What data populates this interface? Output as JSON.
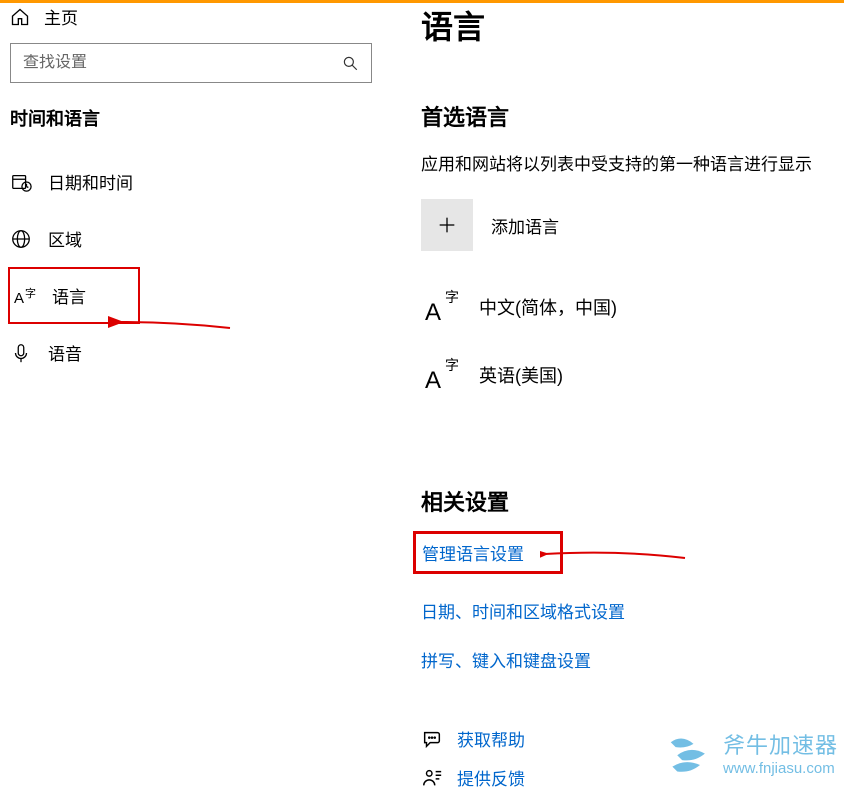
{
  "sidebar": {
    "home_label": "主页",
    "search_placeholder": "查找设置",
    "section_title": "时间和语言",
    "items": [
      {
        "label": "日期和时间"
      },
      {
        "label": "区域"
      },
      {
        "label": "语言"
      },
      {
        "label": "语音"
      }
    ]
  },
  "main": {
    "title": "语言",
    "preferred_heading": "首选语言",
    "preferred_desc": "应用和网站将以列表中受支持的第一种语言进行显示",
    "add_label": "添加语言",
    "languages": [
      {
        "label": "中文(简体，中国)"
      },
      {
        "label": "英语(美国)"
      }
    ],
    "related_heading": "相关设置",
    "related_links": [
      {
        "label": "管理语言设置"
      },
      {
        "label": "日期、时间和区域格式设置"
      },
      {
        "label": "拼写、键入和键盘设置"
      }
    ],
    "help_links": [
      {
        "label": "获取帮助"
      },
      {
        "label": "提供反馈"
      }
    ]
  },
  "watermark": {
    "title": "斧牛加速器",
    "url": "www.fnjiasu.com"
  }
}
